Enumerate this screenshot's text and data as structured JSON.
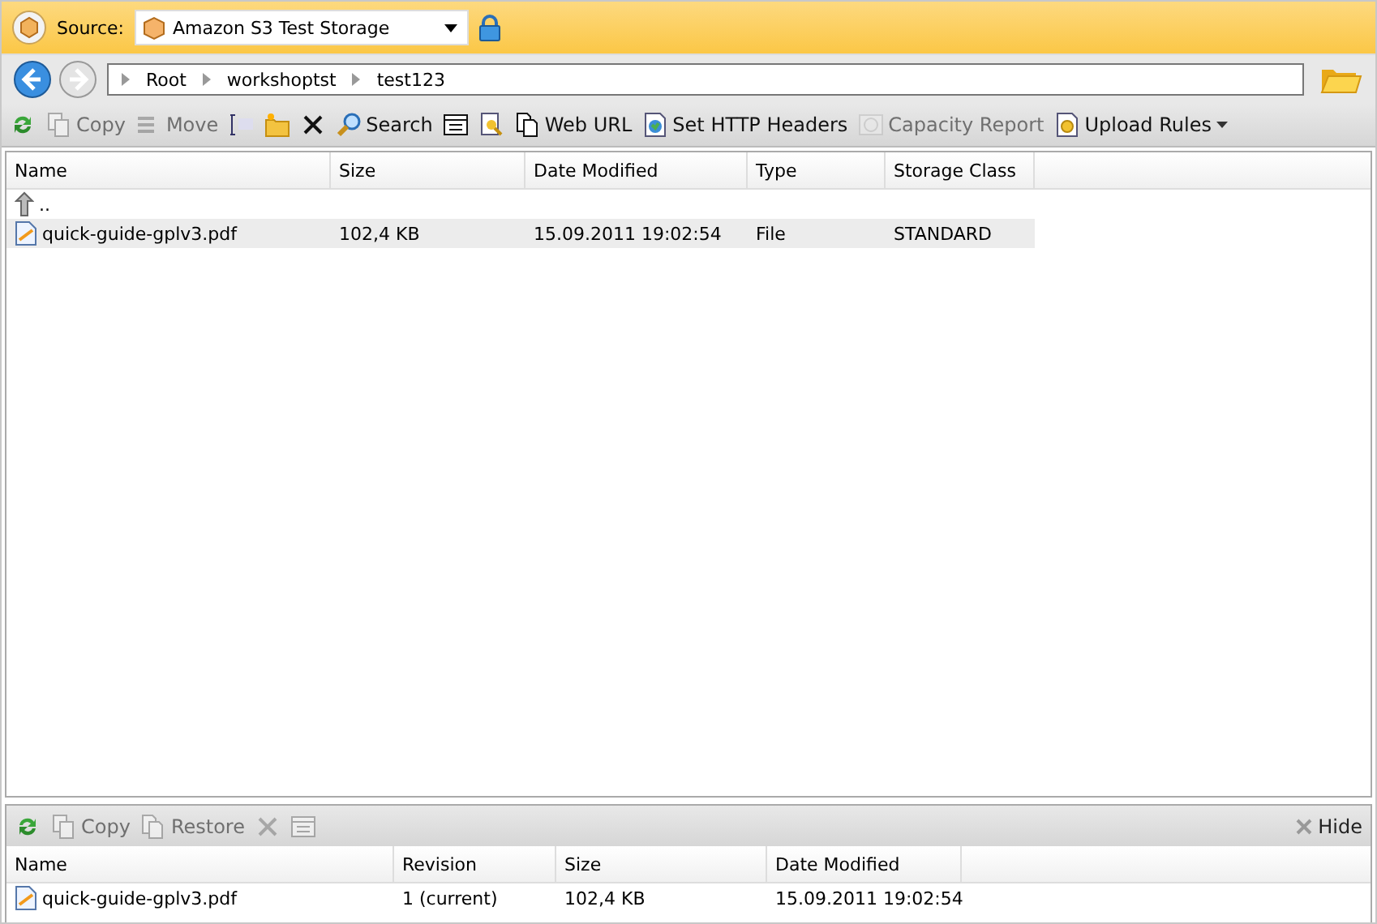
{
  "source": {
    "label": "Source:",
    "value": "Amazon S3 Test Storage"
  },
  "breadcrumb": [
    "Root",
    "workshoptst",
    "test123"
  ],
  "toolbar": [
    {
      "kind": "icon",
      "disabled": false
    },
    {
      "kind": "button",
      "label": "Copy",
      "disabled": true
    },
    {
      "kind": "button",
      "label": "Move",
      "disabled": true
    },
    {
      "kind": "icon",
      "disabled": false
    },
    {
      "kind": "icon",
      "disabled": false
    },
    {
      "kind": "icon",
      "disabled": false
    },
    {
      "kind": "button",
      "label": "Search",
      "disabled": false
    },
    {
      "kind": "icon",
      "disabled": false
    },
    {
      "kind": "icon",
      "disabled": false
    },
    {
      "kind": "button",
      "label": "Web URL",
      "disabled": false
    },
    {
      "kind": "button",
      "label": "Set HTTP Headers",
      "disabled": false
    },
    {
      "kind": "button",
      "label": "Capacity Report",
      "disabled": true
    },
    {
      "kind": "dropdown",
      "label": "Upload Rules",
      "disabled": false
    }
  ],
  "table": {
    "columns": [
      "Name",
      "Size",
      "Date Modified",
      "Type",
      "Storage Class"
    ],
    "rows": [
      {
        "kind": "parent",
        "cells": [
          ".."
        ],
        "selected": false
      },
      {
        "kind": "file",
        "cells": [
          "quick-guide-gplv3.pdf",
          "102,4 KB",
          "15.09.2011 19:02:54",
          "File",
          "STANDARD"
        ],
        "selected": true
      }
    ]
  },
  "versions": {
    "toolbar": [
      {
        "kind": "icon",
        "disabled": false
      },
      {
        "kind": "button",
        "label": "Copy",
        "disabled": true
      },
      {
        "kind": "button",
        "label": "Restore",
        "disabled": true
      },
      {
        "kind": "icon",
        "disabled": true
      },
      {
        "kind": "icon",
        "disabled": true
      }
    ],
    "hide": "Hide",
    "columns": [
      "Name",
      "Revision",
      "Size",
      "Date Modified"
    ],
    "rows": [
      {
        "cells": [
          "quick-guide-gplv3.pdf",
          "1 (current)",
          "102,4 KB",
          "15.09.2011 19:02:54"
        ]
      }
    ]
  }
}
